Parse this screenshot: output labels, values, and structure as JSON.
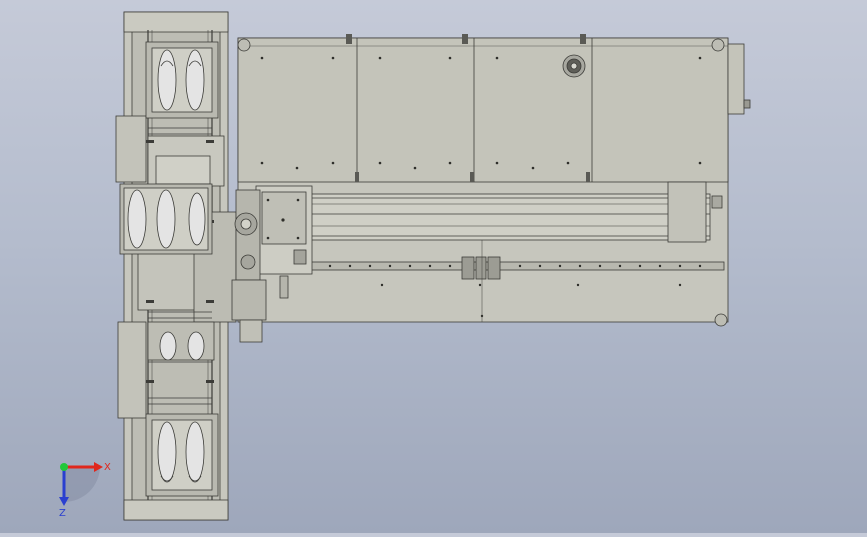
{
  "viewport": {
    "background_top": "#c5cad8",
    "background_bottom": "#9ea7bb"
  },
  "model": {
    "body_color": "#c9c9c0",
    "panel_color": "#c4c4ba",
    "line_color": "#3c3c38",
    "shoe_color": "#e4e4e4",
    "accent_dark": "#5a5a55"
  },
  "triad": {
    "x_label": "X",
    "z_label": "Z",
    "x_color": "#e0271c",
    "z_color": "#2a3fd0",
    "y_color": "#22c83a",
    "shade_color": "#8e96ab"
  }
}
